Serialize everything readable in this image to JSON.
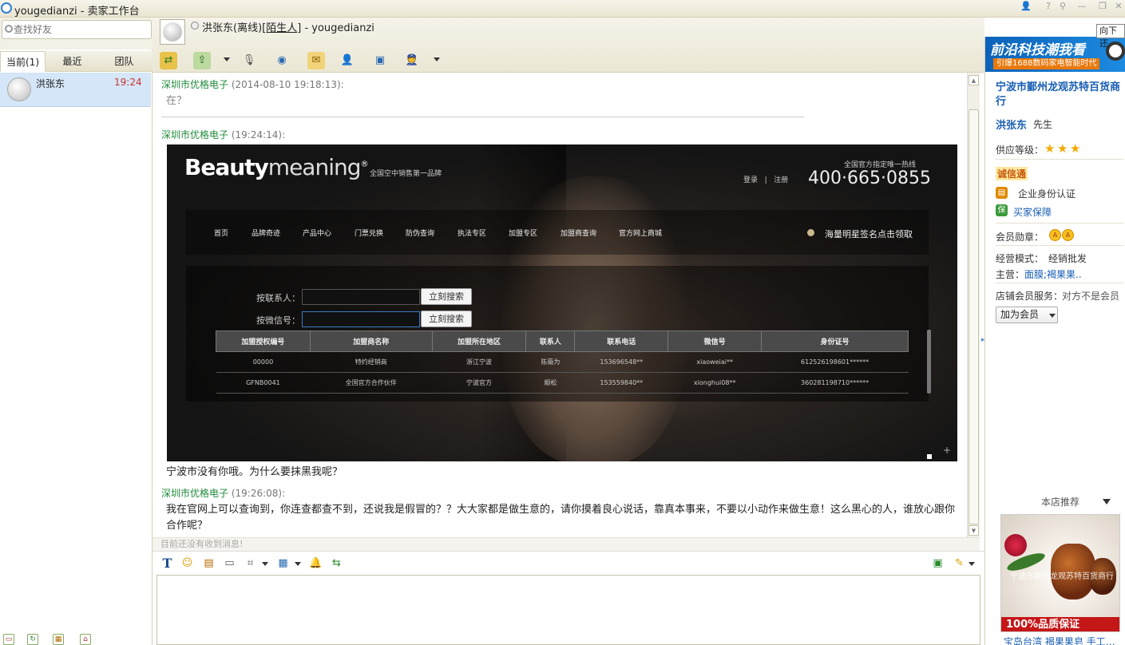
{
  "window": {
    "title": "yougedianzi - 卖家工作台",
    "restore_tip": "向下还"
  },
  "left": {
    "search_placeholder": "查找好友",
    "tabs": [
      {
        "label": "当前(1)",
        "active": true
      },
      {
        "label": "最近",
        "active": false
      },
      {
        "label": "团队",
        "active": false
      }
    ],
    "contacts": [
      {
        "name": "洪张东",
        "time": "19:24"
      }
    ]
  },
  "header": {
    "peer_name": "洪张东(离线)",
    "peer_tag": "[陌生人]",
    "peer_self": " - yougedianzi"
  },
  "messages": [
    {
      "sender": "深圳市优格电子",
      "time": "(2014-08-10 19:18:13):",
      "text": "在？"
    },
    {
      "sender": "深圳市优格电子",
      "time": "(19:24:14):",
      "text": "宁波市没有你哦。为什么要抹黑我呢？"
    },
    {
      "sender": "深圳市优格电子",
      "time": "(19:26:08):",
      "text": "我在官网上可以查询到，你连查都查不到，还说我是假冒的？？大大家都是做生意的，请你摸着良心说话，靠真本事来，不要以小动作来做生意！这么黑心的人，谁放心跟你合作呢？"
    }
  ],
  "shot": {
    "brand_bold": "Beauty",
    "brand_light": "meaning",
    "brand_mark": "®",
    "slogan": "全国空中销售第一品牌",
    "hotline_label": "全国官方指定唯一热线",
    "login": "登录",
    "sep": "|",
    "register": "注册",
    "phone": "400·665·0855",
    "nav": [
      "首页",
      "品牌奇迹",
      "产品中心",
      "门票兑换",
      "防伪查询",
      "执法专区",
      "加盟专区",
      "加盟商查询",
      "官方网上商城"
    ],
    "promo": "海量明星签名点击领取",
    "search_contact_label": "按联系人：",
    "search_wechat_label": "按微信号：",
    "search_btn": "立刻搜索",
    "table_headers": [
      "加盟授权编号",
      "加盟商名称",
      "加盟所在地区",
      "联系人",
      "联系电话",
      "微信号",
      "身份证号"
    ],
    "table_rows": [
      [
        "00000",
        "特约经销商",
        "浙江宁波",
        "陈薇为",
        "153696548**",
        "xiaoweiai**",
        "612526198601******"
      ],
      [
        "GFNB0041",
        "全国官方合作伙伴",
        "宁波官方",
        "顺松",
        "153559840**",
        "xionghui08**",
        "360281198710******"
      ]
    ]
  },
  "status_line": "目前还没有收到消息!",
  "right": {
    "banner_title": "前沿科技潮我看",
    "banner_sub": "引爆1688数码家电智能时代",
    "shop_name": "宁波市鄞州龙观苏特百货商行",
    "person_name": "洪张东",
    "person_title": "先生",
    "supply_label": "供应等级：",
    "supply_stars": 3,
    "chengxintong": "诚信通",
    "enterprise_auth": "企业身份认证",
    "buyer_protect": "买家保障",
    "medal_label": "会员勋章：",
    "biz_mode_label": "经营模式：",
    "biz_mode_value": "经销批发",
    "main_label": "主营：",
    "main_value": "面膜;褐果果..",
    "member_service_label": "店铺会员服务：",
    "member_service_value": "对方不是会员",
    "join_btn": "加为会员",
    "recommend_title": "本店推荐",
    "rec_watermark": "宁波市鄞州龙观苏特百货商行",
    "rec_badge": "100%品质保证",
    "rec_caption": "宝岛台湾 褐果果皂 手工…"
  },
  "colors": {
    "sender_green": "#1f8a3a",
    "link_blue": "#1a5fb4",
    "contact_highlight": "#d4e6f7",
    "banner_blue": "#0c62b9"
  }
}
